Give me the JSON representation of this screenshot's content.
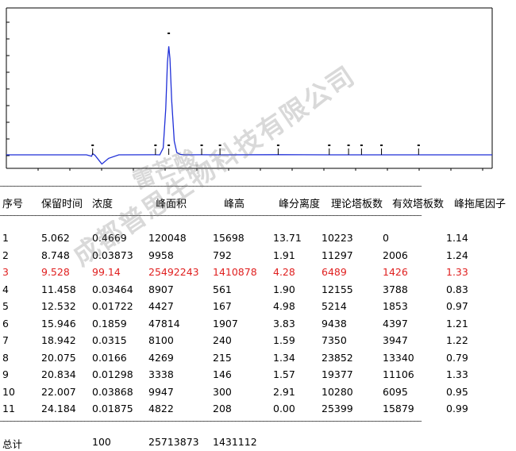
{
  "chart_data": {
    "type": "line",
    "x": [
      0,
      3.0,
      4.7,
      5.0,
      5.062,
      5.2,
      5.6,
      6.0,
      6.6,
      8.748,
      9.0,
      9.2,
      9.35,
      9.45,
      9.528,
      9.6,
      9.7,
      9.85,
      10.0,
      10.2,
      10.5,
      11.458,
      12.532,
      15.946,
      18.942,
      20.075,
      20.834,
      22.007,
      24.184,
      26.0,
      28.5
    ],
    "y": [
      0,
      0,
      0,
      -18000,
      15698,
      -6000,
      -120000,
      -45000,
      0,
      792,
      0,
      90000,
      600000,
      1200000,
      1410878,
      1250000,
      700000,
      180000,
      30000,
      5000,
      0,
      561,
      167,
      1907,
      240,
      215,
      146,
      300,
      208,
      0,
      0
    ],
    "xlim": [
      0,
      28.5
    ],
    "ylim": [
      -120000,
      1600000
    ],
    "peaks": [
      5.062,
      8.748,
      9.528,
      11.458,
      12.532,
      15.946,
      18.942,
      20.075,
      20.834,
      22.007,
      24.184
    ],
    "line_color": "#1f2fd8",
    "grid": false
  },
  "table": {
    "headers": [
      "序号",
      "保留时间",
      "浓度",
      "峰面积",
      "峰高",
      "峰分离度",
      "理论塔板数",
      "有效塔板数",
      "峰拖尾因子"
    ],
    "rows": [
      [
        "1",
        "5.062",
        "0.4669",
        "120048",
        "15698",
        "13.71",
        "10223",
        "0",
        "1.14"
      ],
      [
        "2",
        "8.748",
        "0.03873",
        "9958",
        "792",
        "1.91",
        "11297",
        "2006",
        "1.24"
      ],
      [
        "3",
        "9.528",
        "99.14",
        "25492243",
        "1410878",
        "4.28",
        "6489",
        "1426",
        "1.33"
      ],
      [
        "4",
        "11.458",
        "0.03464",
        "8907",
        "561",
        "1.90",
        "12155",
        "3788",
        "0.83"
      ],
      [
        "5",
        "12.532",
        "0.01722",
        "4427",
        "167",
        "4.98",
        "5214",
        "1853",
        "0.97"
      ],
      [
        "6",
        "15.946",
        "0.1859",
        "47814",
        "1907",
        "3.83",
        "9438",
        "4397",
        "1.21"
      ],
      [
        "7",
        "18.942",
        "0.0315",
        "8100",
        "240",
        "1.59",
        "7350",
        "3947",
        "1.22"
      ],
      [
        "8",
        "20.075",
        "0.0166",
        "4269",
        "215",
        "1.34",
        "23852",
        "13340",
        "0.79"
      ],
      [
        "9",
        "20.834",
        "0.01298",
        "3338",
        "146",
        "1.57",
        "19377",
        "11106",
        "1.33"
      ],
      [
        "10",
        "22.007",
        "0.03868",
        "9947",
        "300",
        "2.91",
        "10280",
        "6095",
        "0.95"
      ],
      [
        "11",
        "24.184",
        "0.01875",
        "4822",
        "208",
        "0.00",
        "25399",
        "15879",
        "0.99"
      ]
    ],
    "highlight_row": 3,
    "highlight_color": "#e02020",
    "total": {
      "label": "总计",
      "concentration": "100",
      "area": "25713873",
      "height": "1431112"
    }
  },
  "watermark": {
    "text1": "雷芒酸",
    "text2": "成都普思生物科技有限公司"
  }
}
